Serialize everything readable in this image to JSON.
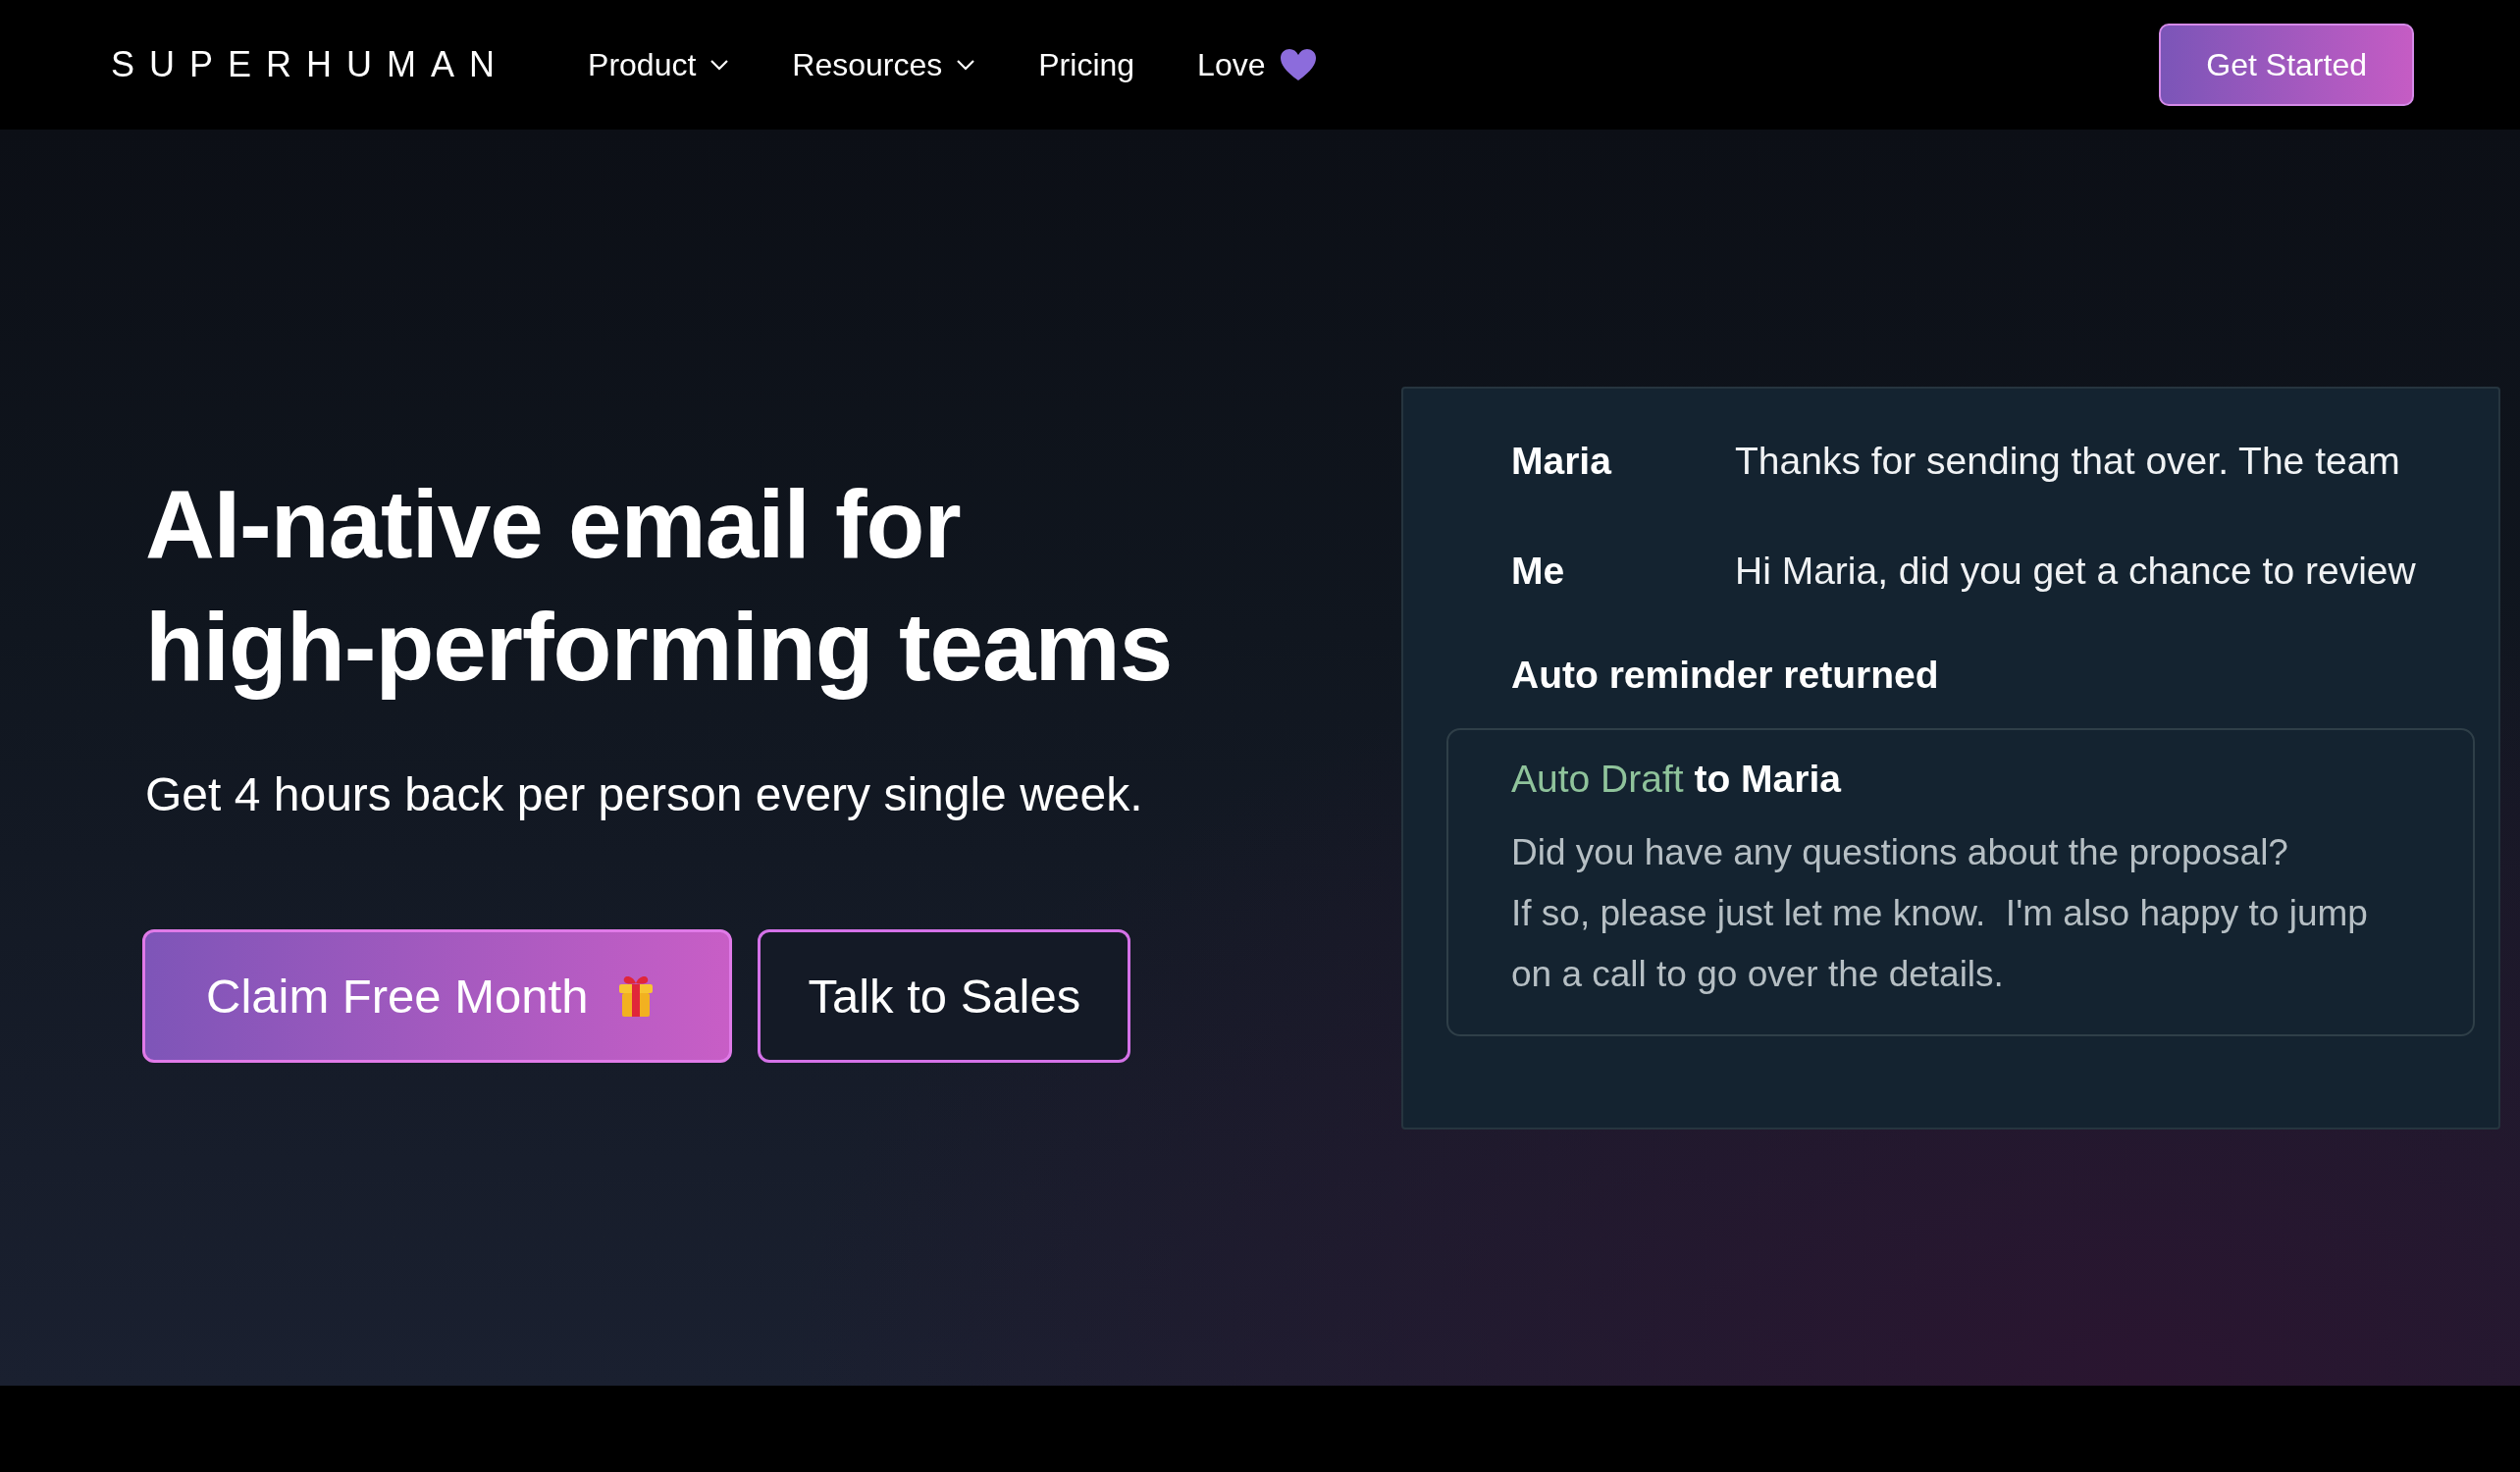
{
  "nav": {
    "logo": "SUPERHUMAN",
    "items": [
      {
        "label": "Product",
        "dropdown": true,
        "heart": false
      },
      {
        "label": "Resources",
        "dropdown": true,
        "heart": false
      },
      {
        "label": "Pricing",
        "dropdown": false,
        "heart": false
      },
      {
        "label": "Love",
        "dropdown": false,
        "heart": true
      }
    ],
    "cta": "Get Started"
  },
  "hero": {
    "headline_lines": [
      "AI-native email for",
      "high-performing teams"
    ],
    "subtitle": "Get 4 hours back per person every single week.",
    "buttons": [
      {
        "label": "Claim Free Month",
        "kind": "primary"
      },
      {
        "label": "Talk to Sales",
        "kind": "outline"
      }
    ]
  },
  "email_card": {
    "threads": [
      {
        "sender": "Maria",
        "preview": "Thanks for sending that over. The team"
      },
      {
        "sender": "Me",
        "preview": "Hi Maria, did you get a chance to review"
      }
    ],
    "status": "Auto reminder returned",
    "draft": {
      "label": "Auto Draft",
      "recipient": "to Maria",
      "body_lines": [
        "Did you have any questions about the proposal?",
        "If so, please just let me know.  I'm also happy to jump",
        "on a call to go over the details."
      ]
    }
  }
}
